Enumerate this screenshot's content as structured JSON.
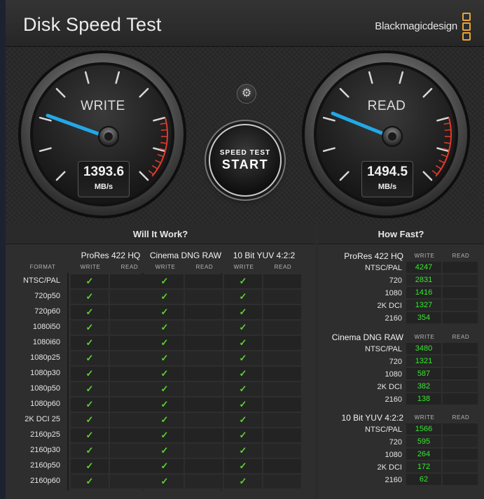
{
  "app": {
    "title": "Disk Speed Test",
    "brand": "Blackmagicdesign",
    "brand_color": "#e9a431"
  },
  "gauges": {
    "write": {
      "label": "WRITE",
      "value": "1393.6",
      "unit": "MB/s"
    },
    "read": {
      "label": "READ",
      "value": "1494.5",
      "unit": "MB/s"
    },
    "needle_color": "#22a8e8",
    "redline_color": "#e03a2a"
  },
  "start_button": {
    "small": "SPEED TEST",
    "big": "START"
  },
  "settings_icon": "gear-icon",
  "will_it_work": {
    "title": "Will It Work?",
    "format_label": "FORMAT",
    "groups": [
      {
        "name": "ProRes 422 HQ",
        "write": "WRITE",
        "read": "READ"
      },
      {
        "name": "Cinema DNG RAW",
        "write": "WRITE",
        "read": "READ"
      },
      {
        "name": "10 Bit YUV 4:2:2",
        "write": "WRITE",
        "read": "READ"
      }
    ],
    "formats": [
      "NTSC/PAL",
      "720p50",
      "720p60",
      "1080i50",
      "1080i60",
      "1080p25",
      "1080p30",
      "1080p50",
      "1080p60",
      "2K DCI 25",
      "2160p25",
      "2160p30",
      "2160p50",
      "2160p60"
    ],
    "check_glyph": "✓",
    "check_color": "#5ad62c"
  },
  "how_fast": {
    "title": "How Fast?",
    "write_label": "WRITE",
    "read_label": "READ",
    "groups": [
      {
        "name": "ProRes 422 HQ",
        "rows": [
          {
            "res": "NTSC/PAL",
            "write": "4247"
          },
          {
            "res": "720",
            "write": "2831"
          },
          {
            "res": "1080",
            "write": "1416"
          },
          {
            "res": "2K DCI",
            "write": "1327"
          },
          {
            "res": "2160",
            "write": "354"
          }
        ]
      },
      {
        "name": "Cinema DNG RAW",
        "rows": [
          {
            "res": "NTSC/PAL",
            "write": "3480"
          },
          {
            "res": "720",
            "write": "1321"
          },
          {
            "res": "1080",
            "write": "587"
          },
          {
            "res": "2K DCI",
            "write": "382"
          },
          {
            "res": "2160",
            "write": "138"
          }
        ]
      },
      {
        "name": "10 Bit YUV 4:2:2",
        "rows": [
          {
            "res": "NTSC/PAL",
            "write": "1566"
          },
          {
            "res": "720",
            "write": "595"
          },
          {
            "res": "1080",
            "write": "264"
          },
          {
            "res": "2K DCI",
            "write": "172"
          },
          {
            "res": "2160",
            "write": "62"
          }
        ]
      }
    ],
    "value_color": "#37e82f"
  }
}
